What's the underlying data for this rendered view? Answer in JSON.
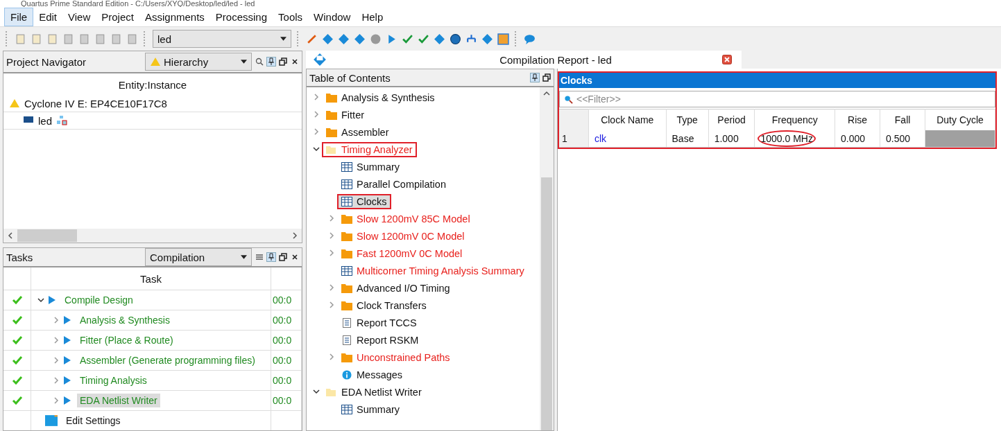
{
  "window": {
    "title": "Quartus Prime Standard Edition - C:/Users/XYQ/Desktop/led/led - led"
  },
  "menu": [
    {
      "label": "File",
      "selected": true
    },
    {
      "label": "Edit",
      "selected": false
    },
    {
      "label": "View",
      "selected": false
    },
    {
      "label": "Project",
      "selected": false
    },
    {
      "label": "Assignments",
      "selected": false
    },
    {
      "label": "Processing",
      "selected": false
    },
    {
      "label": "Tools",
      "selected": false
    },
    {
      "label": "Window",
      "selected": false
    },
    {
      "label": "Help",
      "selected": false
    }
  ],
  "toolbar": {
    "revision": "led"
  },
  "project_navigator": {
    "title": "Project Navigator",
    "view": "Hierarchy",
    "column": "Entity:Instance",
    "tree": [
      {
        "label": "Cyclone IV E: EP4CE10F17C8",
        "kind": "device",
        "children": [
          {
            "label": "led",
            "kind": "entity"
          }
        ]
      }
    ]
  },
  "tasks": {
    "title": "Tasks",
    "flow": "Compilation",
    "column": "Task",
    "rows": [
      {
        "label": "Compile Design",
        "done": true,
        "kind": "flow",
        "expanded": true,
        "time": "00:0",
        "selected": false,
        "children": [
          {
            "label": "Analysis & Synthesis",
            "done": true,
            "kind": "flow",
            "expanded": false,
            "time": "00:0",
            "selected": false
          },
          {
            "label": "Fitter (Place & Route)",
            "done": true,
            "kind": "flow",
            "expanded": false,
            "time": "00:0",
            "selected": false
          },
          {
            "label": "Assembler (Generate programming files)",
            "done": true,
            "kind": "flow",
            "expanded": false,
            "time": "00:0",
            "selected": false
          },
          {
            "label": "Timing Analysis",
            "done": true,
            "kind": "flow",
            "expanded": false,
            "time": "00:0",
            "selected": false
          },
          {
            "label": "EDA Netlist Writer",
            "done": true,
            "kind": "flow",
            "expanded": false,
            "time": "00:0",
            "selected": true
          }
        ]
      },
      {
        "label": "Edit Settings",
        "done": false,
        "kind": "settings",
        "selected": false
      }
    ]
  },
  "report": {
    "tab": "Compilation Report - led",
    "toc_title": "Table of Contents",
    "toc": [
      {
        "label": "Analysis & Synthesis",
        "kind": "folder",
        "red": false,
        "expanded": false,
        "selected": false,
        "highlighted": false
      },
      {
        "label": "Fitter",
        "kind": "folder",
        "red": false,
        "expanded": false,
        "selected": false,
        "highlighted": false
      },
      {
        "label": "Assembler",
        "kind": "folder",
        "red": false,
        "expanded": false,
        "selected": false,
        "highlighted": false
      },
      {
        "label": "Timing Analyzer",
        "kind": "folder",
        "red": true,
        "expanded": true,
        "selected": false,
        "highlighted": true,
        "children": [
          {
            "label": "Summary",
            "kind": "table",
            "red": false,
            "selected": false,
            "highlighted": false
          },
          {
            "label": "Parallel Compilation",
            "kind": "table",
            "red": false,
            "selected": false,
            "highlighted": false
          },
          {
            "label": "Clocks",
            "kind": "table",
            "red": false,
            "selected": true,
            "highlighted": true
          },
          {
            "label": "Slow 1200mV 85C Model",
            "kind": "folder",
            "red": true,
            "expanded": false,
            "selected": false,
            "highlighted": false
          },
          {
            "label": "Slow 1200mV 0C Model",
            "kind": "folder",
            "red": true,
            "expanded": false,
            "selected": false,
            "highlighted": false
          },
          {
            "label": "Fast 1200mV 0C Model",
            "kind": "folder",
            "red": true,
            "expanded": false,
            "selected": false,
            "highlighted": false
          },
          {
            "label": "Multicorner Timing Analysis Summary",
            "kind": "table",
            "red": true,
            "selected": false,
            "highlighted": false
          },
          {
            "label": "Advanced I/O Timing",
            "kind": "folder",
            "red": false,
            "expanded": false,
            "selected": false,
            "highlighted": false
          },
          {
            "label": "Clock Transfers",
            "kind": "folder",
            "red": false,
            "expanded": false,
            "selected": false,
            "highlighted": false
          },
          {
            "label": "Report TCCS",
            "kind": "text",
            "red": false,
            "selected": false,
            "highlighted": false
          },
          {
            "label": "Report RSKM",
            "kind": "text",
            "red": false,
            "selected": false,
            "highlighted": false
          },
          {
            "label": "Unconstrained Paths",
            "kind": "folder",
            "red": true,
            "expanded": false,
            "selected": false,
            "highlighted": false
          },
          {
            "label": "Messages",
            "kind": "info",
            "red": false,
            "selected": false,
            "highlighted": false
          }
        ]
      },
      {
        "label": "EDA Netlist Writer",
        "kind": "folder",
        "red": false,
        "expanded": true,
        "selected": false,
        "highlighted": false,
        "children": [
          {
            "label": "Summary",
            "kind": "table",
            "red": false,
            "selected": false,
            "highlighted": false
          }
        ]
      }
    ],
    "panel": {
      "title": "Clocks",
      "highlighted": true,
      "filter_placeholder": "<<Filter>>",
      "columns": [
        "Clock Name",
        "Type",
        "Period",
        "Frequency",
        "Rise",
        "Fall",
        "Duty Cycle"
      ],
      "rows": [
        {
          "index": "1",
          "cells": [
            {
              "text": "clk",
              "link": true,
              "circled": false
            },
            {
              "text": "Base",
              "link": false,
              "circled": false
            },
            {
              "text": "1.000",
              "link": false,
              "circled": false
            },
            {
              "text": "1000.0 MHz",
              "link": false,
              "circled": true
            },
            {
              "text": "0.000",
              "link": false,
              "circled": false
            },
            {
              "text": "0.500",
              "link": false,
              "circled": false
            },
            {
              "text": "",
              "shaded": true
            }
          ]
        }
      ]
    }
  }
}
